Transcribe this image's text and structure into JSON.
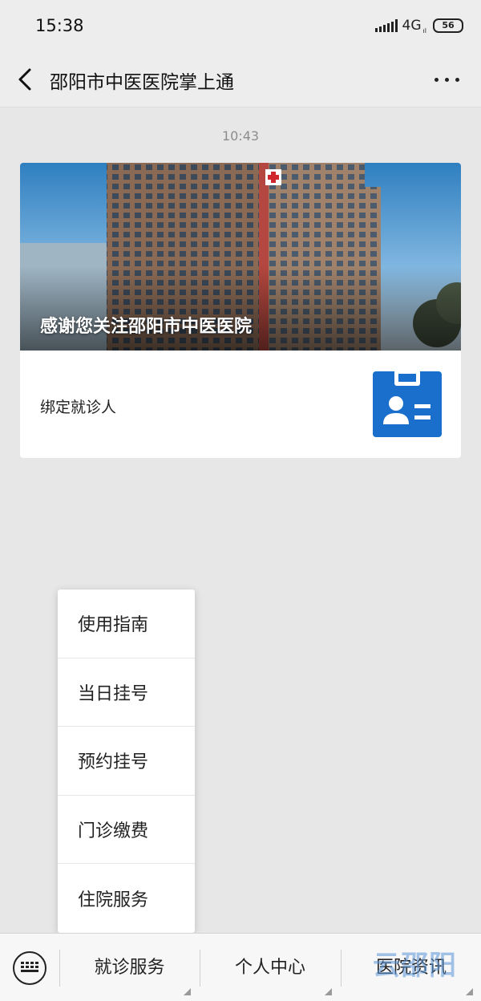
{
  "status_bar": {
    "time": "15:38",
    "network": "4G",
    "network_sub": "ıl",
    "battery": "56"
  },
  "title_bar": {
    "title": "邵阳市中医医院掌上通",
    "back_icon": "chevron-left-icon",
    "more_icon": "more-dots-icon"
  },
  "chat": {
    "timestamp": "10:43",
    "card": {
      "headline": "感谢您关注邵阳市中医医院",
      "row_label": "绑定就诊人",
      "row_icon": "id-badge-icon"
    }
  },
  "popup_menu": {
    "items": [
      "使用指南",
      "当日挂号",
      "预约挂号",
      "门诊缴费",
      "住院服务"
    ]
  },
  "bottom_menu": {
    "keyboard_icon": "keyboard-icon",
    "tabs": [
      "就诊服务",
      "个人中心",
      "医院资讯"
    ]
  },
  "watermark": "云邵阳",
  "colors": {
    "background": "#e7e7e7",
    "bar": "#ededed",
    "badge_blue": "#1a6fcc"
  }
}
